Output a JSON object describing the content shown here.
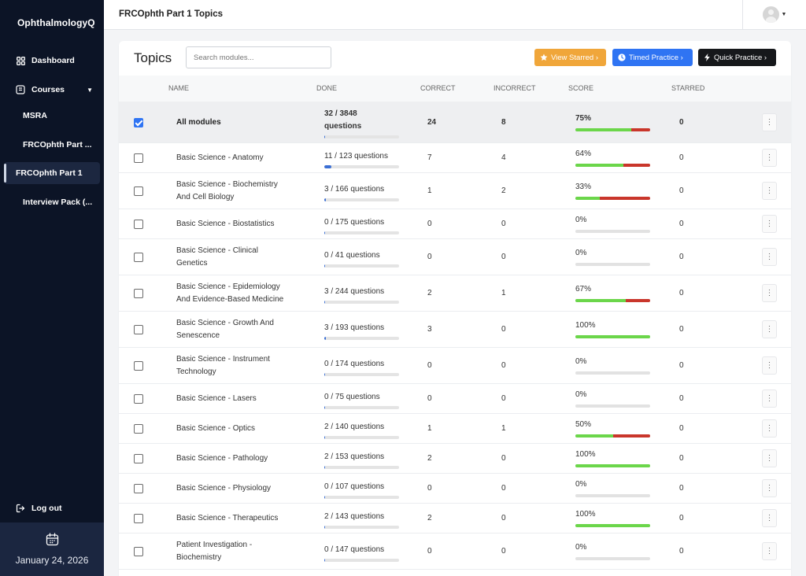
{
  "app": {
    "brand": "OphthalmologyQ"
  },
  "sidebar": {
    "dashboard_label": "Dashboard",
    "courses_label": "Courses",
    "courses": [
      {
        "label": "MSRA"
      },
      {
        "label": "FRCOphth Part ..."
      },
      {
        "label": "FRCOphth Part 1"
      },
      {
        "label": "Interview Pack (..."
      }
    ],
    "logout_label": "Log out",
    "date": "January 24, 2026"
  },
  "header": {
    "title": "FRCOphth Part 1 Topics"
  },
  "main": {
    "title": "Topics",
    "search_placeholder": "Search modules...",
    "buttons": {
      "view_starred": "View Starred ›",
      "timed_practice": "Timed Practice ›",
      "quick_practice": "Quick Practice ›"
    },
    "columns": [
      "NAME",
      "DONE",
      "CORRECT",
      "INCORRECT",
      "SCORE",
      "STARRED"
    ],
    "all_row": {
      "name": "All modules",
      "done_line1": "32 / 3848",
      "done_line2": "questions",
      "done_fraction": 0.008,
      "correct": "24",
      "incorrect": "8",
      "score": "75%",
      "correct_frac": 0.75,
      "incorrect_frac": 0.25,
      "starred": "0",
      "checked": true
    },
    "rows": [
      {
        "name_line1": "Basic Science - Anatomy",
        "name_line2": "",
        "done": "11 / 123 questions",
        "done_fraction": 0.09,
        "correct": "7",
        "incorrect": "4",
        "score": "64%",
        "correct_frac": 0.64,
        "incorrect_frac": 0.36,
        "starred": "0"
      },
      {
        "name_line1": "Basic Science - Biochemistry",
        "name_line2": "And Cell Biology",
        "done": "3 / 166 questions",
        "done_fraction": 0.018,
        "correct": "1",
        "incorrect": "2",
        "score": "33%",
        "correct_frac": 0.33,
        "incorrect_frac": 0.67,
        "starred": "0"
      },
      {
        "name_line1": "Basic Science - Biostatistics",
        "name_line2": "",
        "done": "0 / 175 questions",
        "done_fraction": 0,
        "correct": "0",
        "incorrect": "0",
        "score": "0%",
        "correct_frac": 0,
        "incorrect_frac": 0,
        "starred": "0"
      },
      {
        "name_line1": "Basic Science - Clinical",
        "name_line2": "Genetics",
        "done": "0 / 41 questions",
        "done_fraction": 0,
        "correct": "0",
        "incorrect": "0",
        "score": "0%",
        "correct_frac": 0,
        "incorrect_frac": 0,
        "starred": "0"
      },
      {
        "name_line1": "Basic Science - Epidemiology",
        "name_line2": "And Evidence-Based Medicine",
        "done": "3 / 244 questions",
        "done_fraction": 0.012,
        "correct": "2",
        "incorrect": "1",
        "score": "67%",
        "correct_frac": 0.67,
        "incorrect_frac": 0.33,
        "starred": "0"
      },
      {
        "name_line1": "Basic Science - Growth And",
        "name_line2": "Senescence",
        "done": "3 / 193 questions",
        "done_fraction": 0.016,
        "correct": "3",
        "incorrect": "0",
        "score": "100%",
        "correct_frac": 1,
        "incorrect_frac": 0,
        "starred": "0"
      },
      {
        "name_line1": "Basic Science - Instrument",
        "name_line2": "Technology",
        "done": "0 / 174 questions",
        "done_fraction": 0,
        "correct": "0",
        "incorrect": "0",
        "score": "0%",
        "correct_frac": 0,
        "incorrect_frac": 0,
        "starred": "0"
      },
      {
        "name_line1": "Basic Science - Lasers",
        "name_line2": "",
        "done": "0 / 75 questions",
        "done_fraction": 0,
        "correct": "0",
        "incorrect": "0",
        "score": "0%",
        "correct_frac": 0,
        "incorrect_frac": 0,
        "starred": "0"
      },
      {
        "name_line1": "Basic Science - Optics",
        "name_line2": "",
        "done": "2 / 140 questions",
        "done_fraction": 0.014,
        "correct": "1",
        "incorrect": "1",
        "score": "50%",
        "correct_frac": 0.5,
        "incorrect_frac": 0.5,
        "starred": "0"
      },
      {
        "name_line1": "Basic Science - Pathology",
        "name_line2": "",
        "done": "2 / 153 questions",
        "done_fraction": 0.013,
        "correct": "2",
        "incorrect": "0",
        "score": "100%",
        "correct_frac": 1,
        "incorrect_frac": 0,
        "starred": "0"
      },
      {
        "name_line1": "Basic Science - Physiology",
        "name_line2": "",
        "done": "0 / 107 questions",
        "done_fraction": 0,
        "correct": "0",
        "incorrect": "0",
        "score": "0%",
        "correct_frac": 0,
        "incorrect_frac": 0,
        "starred": "0"
      },
      {
        "name_line1": "Basic Science - Therapeutics",
        "name_line2": "",
        "done": "2 / 143 questions",
        "done_fraction": 0.014,
        "correct": "2",
        "incorrect": "0",
        "score": "100%",
        "correct_frac": 1,
        "incorrect_frac": 0,
        "starred": "0"
      },
      {
        "name_line1": "Patient Investigation -",
        "name_line2": "Biochemistry",
        "done": "0 / 147 questions",
        "done_fraction": 0,
        "correct": "0",
        "incorrect": "0",
        "score": "0%",
        "correct_frac": 0,
        "incorrect_frac": 0,
        "starred": "0"
      }
    ]
  },
  "colors": {
    "sidebar_bg": "#0c1426",
    "starred_btn": "#f0a63a",
    "timed_btn": "#2f74f3",
    "quick_btn": "#16181b",
    "score_green": "#6bd64a",
    "score_red": "#c9362b",
    "progress_blue": "#3b6fd4"
  },
  "icons": {
    "dashboard": "grid-icon",
    "courses": "book-icon",
    "logout": "logout-icon",
    "calendar": "calendar-icon",
    "star": "star-icon",
    "clock": "clock-icon",
    "bolt": "bolt-icon"
  }
}
